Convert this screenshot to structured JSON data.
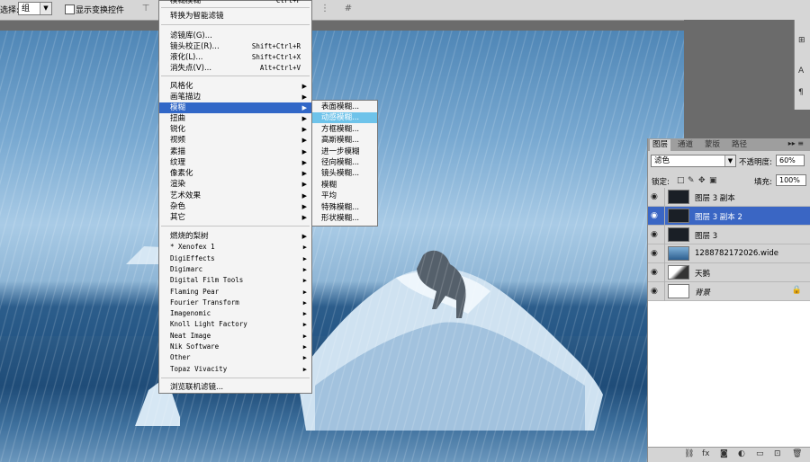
{
  "options_bar": {
    "select_label": "选择:",
    "select_value": "组",
    "show_transform_label": "显示变换控件"
  },
  "filter_menu": {
    "items": [
      {
        "label": "模糊模糊",
        "shortcut": "Ctrl+F"
      },
      {
        "label": "转换为智能滤镜"
      },
      {
        "label": "滤镜库(G)..."
      },
      {
        "label": "镜头校正(R)...",
        "shortcut": "Shift+Ctrl+R"
      },
      {
        "label": "液化(L)...",
        "shortcut": "Shift+Ctrl+X"
      },
      {
        "label": "消失点(V)...",
        "shortcut": "Alt+Ctrl+V"
      },
      {
        "label": "风格化"
      },
      {
        "label": "画笔描边"
      },
      {
        "label": "模糊"
      },
      {
        "label": "扭曲"
      },
      {
        "label": "锐化"
      },
      {
        "label": "视频"
      },
      {
        "label": "素描"
      },
      {
        "label": "纹理"
      },
      {
        "label": "像素化"
      },
      {
        "label": "渲染"
      },
      {
        "label": "艺术效果"
      },
      {
        "label": "杂色"
      },
      {
        "label": "其它"
      },
      {
        "label": "燃烧的梨树"
      },
      {
        "label": "* Xenofex 1"
      },
      {
        "label": "DigiEffects"
      },
      {
        "label": "Digimarc"
      },
      {
        "label": "Digital Film Tools"
      },
      {
        "label": "Flaming Pear"
      },
      {
        "label": "Fourier Transform"
      },
      {
        "label": "Imagenomic"
      },
      {
        "label": "Knoll Light Factory"
      },
      {
        "label": "Neat Image"
      },
      {
        "label": "Nik Software"
      },
      {
        "label": "Other"
      },
      {
        "label": "Topaz Vivacity"
      },
      {
        "label": "浏览联机滤镜..."
      }
    ]
  },
  "blur_submenu": {
    "items": [
      "表面模糊...",
      "动感模糊...",
      "方框模糊...",
      "高斯模糊...",
      "进一步模糊",
      "径向模糊...",
      "镜头模糊...",
      "模糊",
      "平均",
      "特殊模糊...",
      "形状模糊..."
    ]
  },
  "layers_panel": {
    "tabs": [
      "图层",
      "通道",
      "蒙版",
      "路径"
    ],
    "blend_mode": "滤色",
    "opacity_label": "不透明度:",
    "opacity_value": "60%",
    "lock_label": "锁定:",
    "fill_label": "填充:",
    "fill_value": "100%",
    "layers": [
      {
        "name": "图层 3 副本"
      },
      {
        "name": "图层 3 副本 2"
      },
      {
        "name": "图层 3"
      },
      {
        "name": "1288782172026.wide"
      },
      {
        "name": "天鹅"
      },
      {
        "name": "背景"
      }
    ]
  },
  "colors": {
    "menu_highlight": "#3167c7",
    "submenu_highlight": "#6ec3ea",
    "layer_selected": "#3a66c4"
  }
}
